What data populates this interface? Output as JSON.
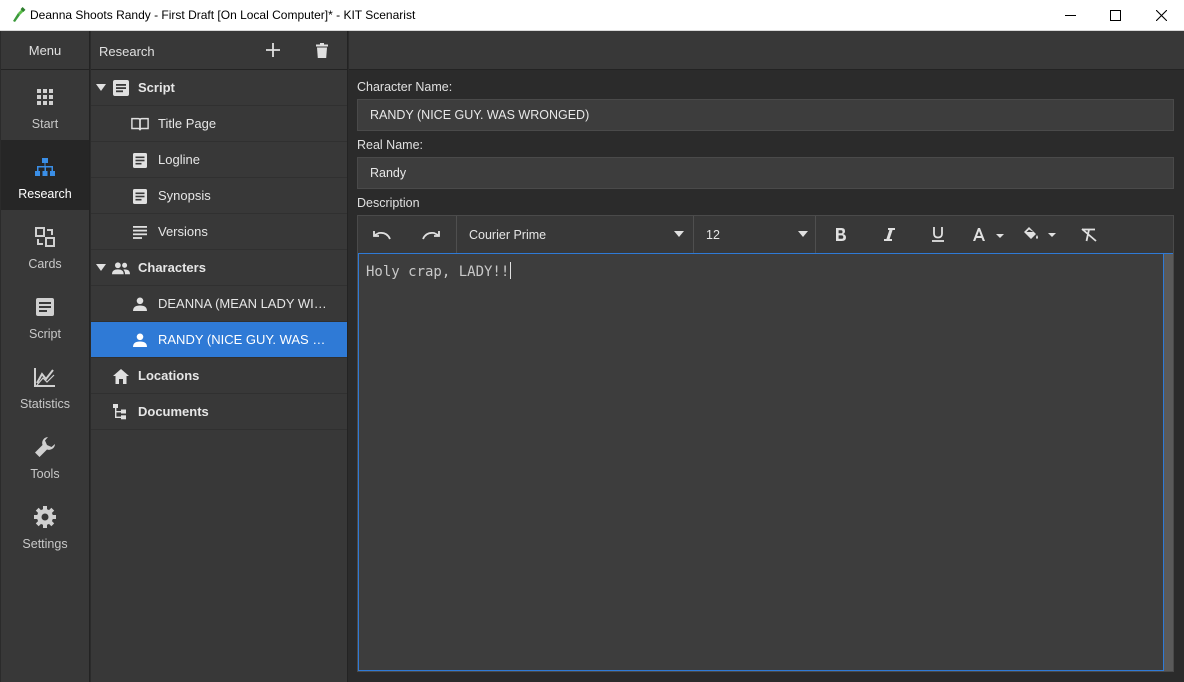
{
  "window": {
    "title": "Deanna Shoots Randy - First Draft [On Local Computer]* - KIT Scenarist",
    "app_icon": "kit-scenarist-logo",
    "controls": [
      "minimize-icon",
      "maximize-icon",
      "close-icon"
    ]
  },
  "nav": {
    "header": "Menu",
    "items": [
      {
        "label": "Start",
        "icon": "grid-icon",
        "active": false
      },
      {
        "label": "Research",
        "icon": "sitemap-icon",
        "active": true
      },
      {
        "label": "Cards",
        "icon": "cards-icon",
        "active": false
      },
      {
        "label": "Script",
        "icon": "document-icon",
        "active": false
      },
      {
        "label": "Statistics",
        "icon": "chart-icon",
        "active": false
      },
      {
        "label": "Tools",
        "icon": "wrench-icon",
        "active": false
      },
      {
        "label": "Settings",
        "icon": "gear-icon",
        "active": false
      }
    ]
  },
  "tree": {
    "header": "Research",
    "add_icon": "plus-icon",
    "delete_icon": "trash-icon",
    "items": [
      {
        "label": "Script",
        "level": 0,
        "expanded": true,
        "icon": "document-icon"
      },
      {
        "label": "Title Page",
        "level": 1,
        "icon": "book-icon"
      },
      {
        "label": "Logline",
        "level": 1,
        "icon": "document-icon"
      },
      {
        "label": "Synopsis",
        "level": 1,
        "icon": "document-icon"
      },
      {
        "label": "Versions",
        "level": 1,
        "icon": "lines-icon"
      },
      {
        "label": "Characters",
        "level": 0,
        "expanded": true,
        "icon": "people-icon"
      },
      {
        "label": "DEANNA (MEAN LADY WITH ...",
        "level": 1,
        "icon": "person-icon"
      },
      {
        "label": "RANDY (NICE GUY. WAS WR...",
        "level": 1,
        "icon": "person-icon",
        "selected": true
      },
      {
        "label": "Locations",
        "level": 0,
        "icon": "home-icon"
      },
      {
        "label": "Documents",
        "level": 0,
        "icon": "tree-structure-icon"
      }
    ]
  },
  "form": {
    "character_name_label": "Character Name:",
    "character_name_value": "RANDY (NICE GUY. WAS WRONGED)",
    "real_name_label": "Real Name:",
    "real_name_value": "Randy",
    "description_label": "Description"
  },
  "editor": {
    "font": "Courier Prime",
    "size": "12",
    "tools": [
      "undo-icon",
      "redo-icon",
      "bold-icon",
      "italic-icon",
      "underline-icon",
      "text-color-icon",
      "fill-color-icon",
      "clear-format-icon"
    ],
    "text": "Holy crap, LADY!!"
  },
  "colors": {
    "accent": "#2f7ad6",
    "background": "#2b2b2b",
    "panel": "#383838"
  }
}
